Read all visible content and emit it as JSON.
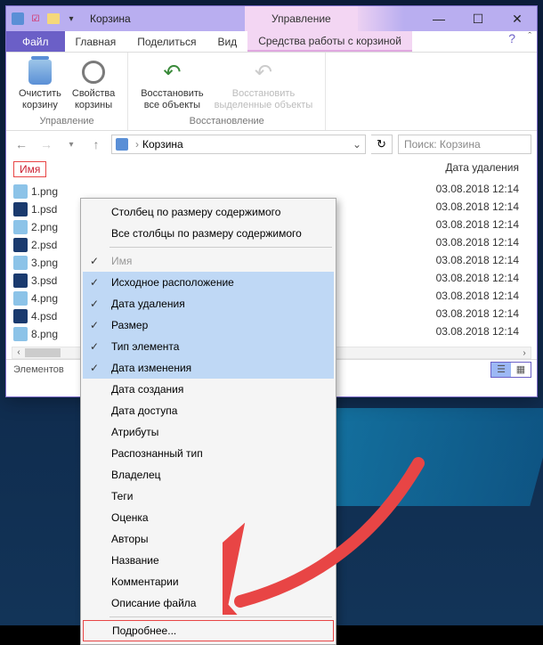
{
  "title": "Корзина",
  "manage_tab": "Управление",
  "ribbon_tabs": {
    "file": "Файл",
    "home": "Главная",
    "share": "Поделиться",
    "view": "Вид",
    "contextual": "Средства работы с корзиной"
  },
  "ribbon": {
    "group1": {
      "btn1": "Очистить\nкорзину",
      "btn2": "Свойства\nкорзины",
      "title": "Управление"
    },
    "group2": {
      "btn1": "Восстановить\nвсе объекты",
      "btn2": "Восстановить\nвыделенные объекты",
      "title": "Восстановление"
    }
  },
  "address": {
    "text": "Корзина",
    "search_placeholder": "Поиск: Корзина"
  },
  "columns": {
    "name": "Имя",
    "date_deleted": "Дата удаления"
  },
  "files": [
    {
      "name": "1.png",
      "type": "png",
      "date": "03.08.2018 12:14"
    },
    {
      "name": "1.psd",
      "type": "psd",
      "date": "03.08.2018 12:14"
    },
    {
      "name": "2.png",
      "type": "png",
      "date": "03.08.2018 12:14"
    },
    {
      "name": "2.psd",
      "type": "psd",
      "date": "03.08.2018 12:14"
    },
    {
      "name": "3.png",
      "type": "png",
      "date": "03.08.2018 12:14"
    },
    {
      "name": "3.psd",
      "type": "psd",
      "date": "03.08.2018 12:14"
    },
    {
      "name": "4.png",
      "type": "png",
      "date": "03.08.2018 12:14"
    },
    {
      "name": "4.psd",
      "type": "psd",
      "date": "03.08.2018 12:14"
    },
    {
      "name": "8.png",
      "type": "png",
      "date": "03.08.2018 12:14"
    }
  ],
  "status": "Элементов",
  "context_menu": {
    "size_col": "Столбец по размеру содержимого",
    "all_cols": "Все столбцы по размеру содержимого",
    "name": "Имя",
    "original_loc": "Исходное расположение",
    "date_deleted": "Дата удаления",
    "size": "Размер",
    "type": "Тип элемента",
    "date_modified": "Дата изменения",
    "date_created": "Дата создания",
    "date_accessed": "Дата доступа",
    "attributes": "Атрибуты",
    "perceived_type": "Распознанный тип",
    "owner": "Владелец",
    "tags": "Теги",
    "rating": "Оценка",
    "authors": "Авторы",
    "title": "Название",
    "comments": "Комментарии",
    "file_desc": "Описание файла",
    "more": "Подробнее..."
  }
}
